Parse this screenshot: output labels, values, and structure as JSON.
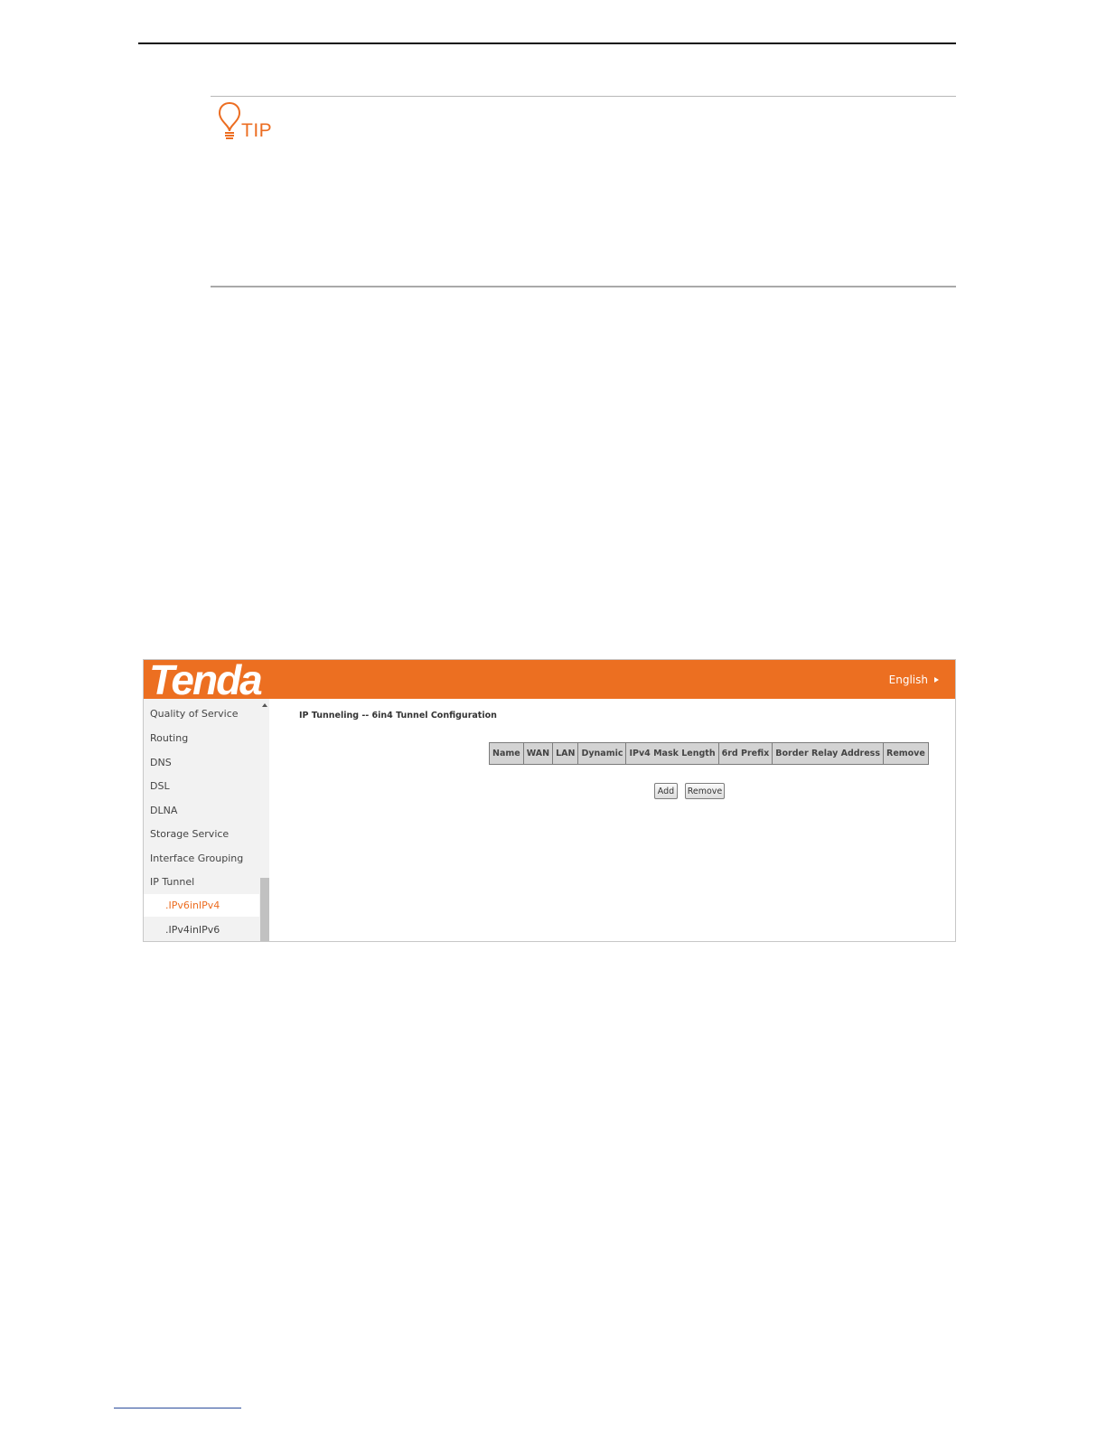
{
  "tip": {
    "label": "TIP",
    "icon": "lightbulb-icon"
  },
  "header": {
    "brand": "Tenda",
    "language": "English"
  },
  "sidebar": {
    "items": [
      {
        "label": "Quality of Service"
      },
      {
        "label": "Routing"
      },
      {
        "label": "DNS"
      },
      {
        "label": "DSL"
      },
      {
        "label": "DLNA"
      },
      {
        "label": "Storage Service"
      },
      {
        "label": "Interface Grouping"
      },
      {
        "label": "IP Tunnel"
      },
      {
        "label": ".IPv6inIPv4",
        "active": true
      },
      {
        "label": ".IPv4inIPv6"
      }
    ]
  },
  "main": {
    "title": "IP Tunneling -- 6in4 Tunnel Configuration",
    "table": {
      "columns": [
        "Name",
        "WAN",
        "LAN",
        "Dynamic",
        "IPv4 Mask Length",
        "6rd Prefix",
        "Border Relay Address",
        "Remove"
      ]
    },
    "buttons": {
      "add": "Add",
      "remove": "Remove"
    }
  },
  "colors": {
    "accent": "#ec6f21",
    "sidebar_bg": "#f2f2f2",
    "table_header_bg": "#d3d3d3"
  }
}
